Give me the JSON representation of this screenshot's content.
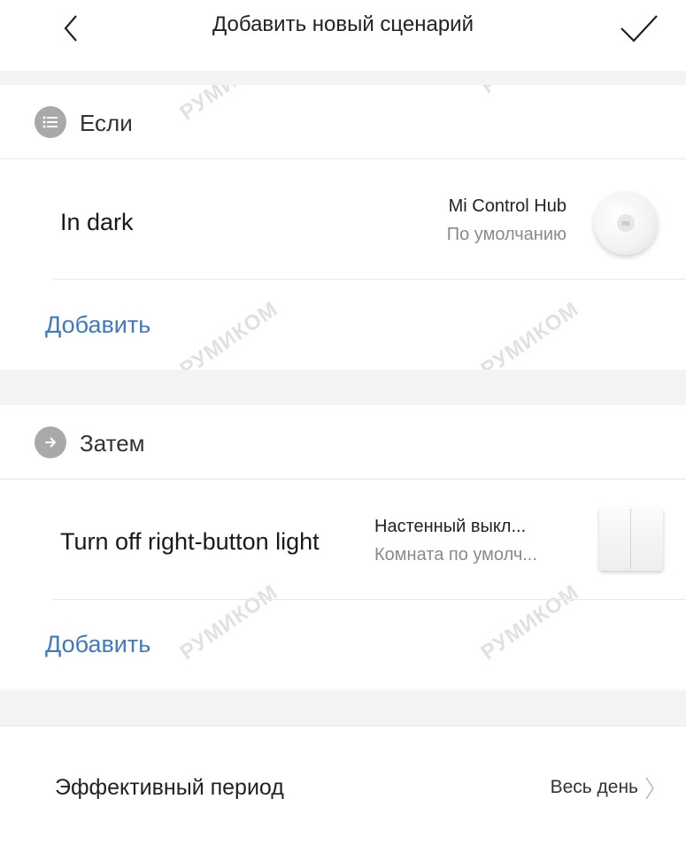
{
  "header": {
    "title": "Добавить новый сценарий"
  },
  "if_section": {
    "label": "Если",
    "condition": {
      "title": "In dark",
      "device": "Mi Control Hub",
      "room": "По умолчанию",
      "device_logo": "mi"
    },
    "add_label": "Добавить"
  },
  "then_section": {
    "label": "Затем",
    "action": {
      "title": "Turn off right-button light",
      "device": "Настенный выкл...",
      "room": "Комната по умолч..."
    },
    "add_label": "Добавить"
  },
  "period": {
    "label": "Эффективный период",
    "value": "Весь день"
  },
  "watermark": "РУМИКОМ",
  "colors": {
    "accent_link": "#3f78c6",
    "section_icon": "#a9a9a9",
    "band": "#f4f4f4"
  },
  "icons": [
    "back-chevron-icon",
    "check-icon",
    "list-icon",
    "arrow-right-circle-icon",
    "chevron-right-icon"
  ]
}
